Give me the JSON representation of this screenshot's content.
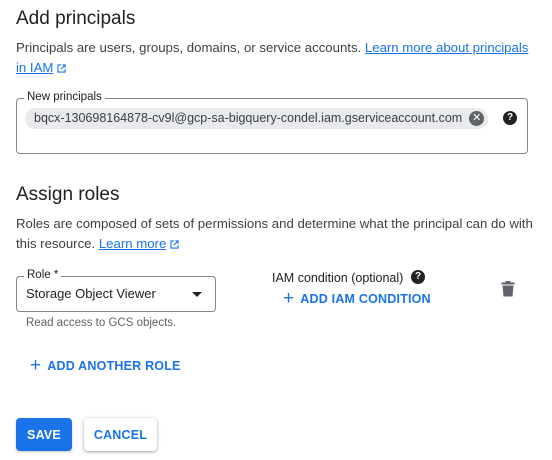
{
  "principals_section": {
    "title": "Add principals",
    "description": "Principals are users, groups, domains, or service accounts.",
    "learn_more_link": "Learn more about principals in IAM",
    "field_label": "New principals",
    "chips": [
      "bqcx-130698164878-cv9l@gcp-sa-bigquery-condel.iam.gserviceaccount.com"
    ]
  },
  "roles_section": {
    "title": "Assign roles",
    "description": "Roles are composed of sets of permissions and determine what the principal can do with this resource.",
    "learn_more_link": "Learn more",
    "role_field_label": "Role *",
    "role_value": "Storage Object Viewer",
    "role_hint": "Read access to GCS objects.",
    "iam_condition_label": "IAM condition (optional)",
    "add_condition_label": "ADD IAM CONDITION",
    "add_role_label": "ADD ANOTHER ROLE"
  },
  "actions": {
    "save_label": "SAVE",
    "cancel_label": "CANCEL"
  },
  "icons": {
    "external_link": "open-in-new-icon",
    "chip_remove": "cancel-icon",
    "help": "help-icon",
    "delete": "trash-icon",
    "add": "plus-icon"
  },
  "colors": {
    "accent": "#1a73e8",
    "text": "#202124",
    "muted": "#5f6368",
    "chip_bg": "#e8eaed"
  }
}
